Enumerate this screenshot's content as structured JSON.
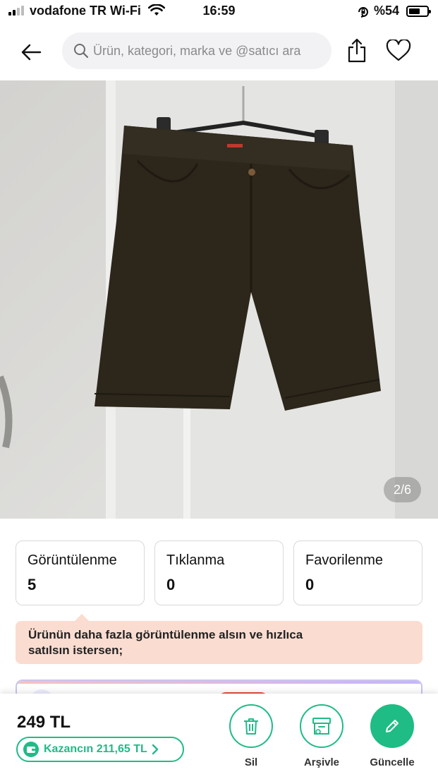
{
  "status_bar": {
    "carrier": "vodafone TR Wi-Fi",
    "time": "16:59",
    "battery": "%54",
    "signal_icon": "signal-bars-icon",
    "wifi_icon": "wifi-icon",
    "orientation_icon": "orientation-lock-icon"
  },
  "header": {
    "back_icon": "arrow-left-icon",
    "search_placeholder": "Ürün, kategori, marka ve @satıcı ara",
    "share_icon": "share-icon",
    "favorite_icon": "heart-icon"
  },
  "gallery": {
    "counter": "2/6",
    "image_alt_icon": "product-photo-shorts"
  },
  "stats": [
    {
      "label": "Görüntülenme",
      "value": "5"
    },
    {
      "label": "Tıklanma",
      "value": "0"
    },
    {
      "label": "Favorilenme",
      "value": "0"
    }
  ],
  "promo": {
    "line1": "Ürünün daha fazla görüntülenme alsın ve hızlıca",
    "line2": "satılsın istersen;"
  },
  "bottom": {
    "price": "249 TL",
    "earnings": "Kazancın 211,65 TL",
    "actions": [
      {
        "label": "Sil",
        "icon": "trash-icon"
      },
      {
        "label": "Arşivle",
        "icon": "archive-icon"
      },
      {
        "label": "Güncelle",
        "icon": "pencil-icon"
      }
    ]
  },
  "colors": {
    "accent_green": "#1fbc85",
    "promo_bg": "#fbdcd0",
    "search_bg": "#f2f2f4"
  }
}
